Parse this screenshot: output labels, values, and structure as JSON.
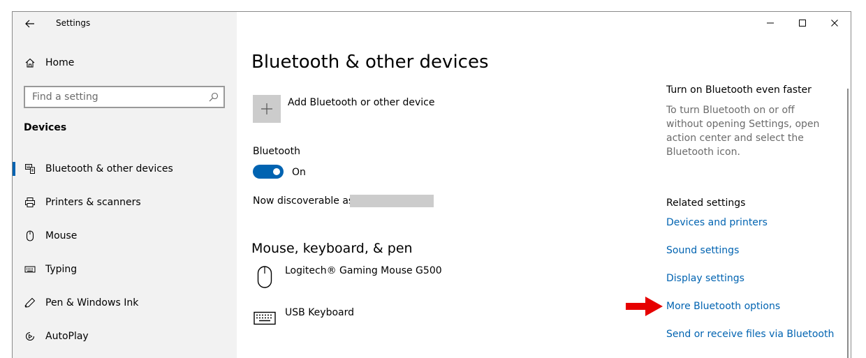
{
  "window": {
    "title": "Settings",
    "back_icon": "back-arrow-icon",
    "controls": [
      "minimize-icon",
      "maximize-icon",
      "close-icon"
    ]
  },
  "sidebar": {
    "home_label": "Home",
    "search_placeholder": "Find a setting",
    "section_title": "Devices",
    "items": [
      {
        "label": "Bluetooth & other devices",
        "icon": "bluetooth-devices-icon",
        "active": true
      },
      {
        "label": "Printers & scanners",
        "icon": "printer-icon",
        "active": false
      },
      {
        "label": "Mouse",
        "icon": "mouse-icon",
        "active": false
      },
      {
        "label": "Typing",
        "icon": "keyboard-icon",
        "active": false
      },
      {
        "label": "Pen & Windows Ink",
        "icon": "pen-icon",
        "active": false
      },
      {
        "label": "AutoPlay",
        "icon": "autoplay-icon",
        "active": false
      }
    ],
    "accent_color": "#0063b1"
  },
  "main": {
    "page_title": "Bluetooth & other devices",
    "add_device_label": "Add Bluetooth or other device",
    "bluetooth_label": "Bluetooth",
    "bluetooth_state": "On",
    "discoverable_label": "Now discoverable as",
    "section_title": "Mouse, keyboard, & pen",
    "devices": [
      {
        "name": "Logitech® Gaming Mouse G500",
        "icon": "mouse-device-icon"
      },
      {
        "name": "USB Keyboard",
        "icon": "keyboard-device-icon"
      }
    ]
  },
  "right": {
    "tip_title": "Turn on Bluetooth even faster",
    "tip_text": "To turn Bluetooth on or off without opening Settings, open action center and select the Bluetooth icon.",
    "related_title": "Related settings",
    "links": [
      "Devices and printers",
      "Sound settings",
      "Display settings",
      "More Bluetooth options",
      "Send or receive files via Bluetooth"
    ],
    "link_color": "#0063b1"
  },
  "annotation": {
    "arrow_color": "#e60000"
  }
}
